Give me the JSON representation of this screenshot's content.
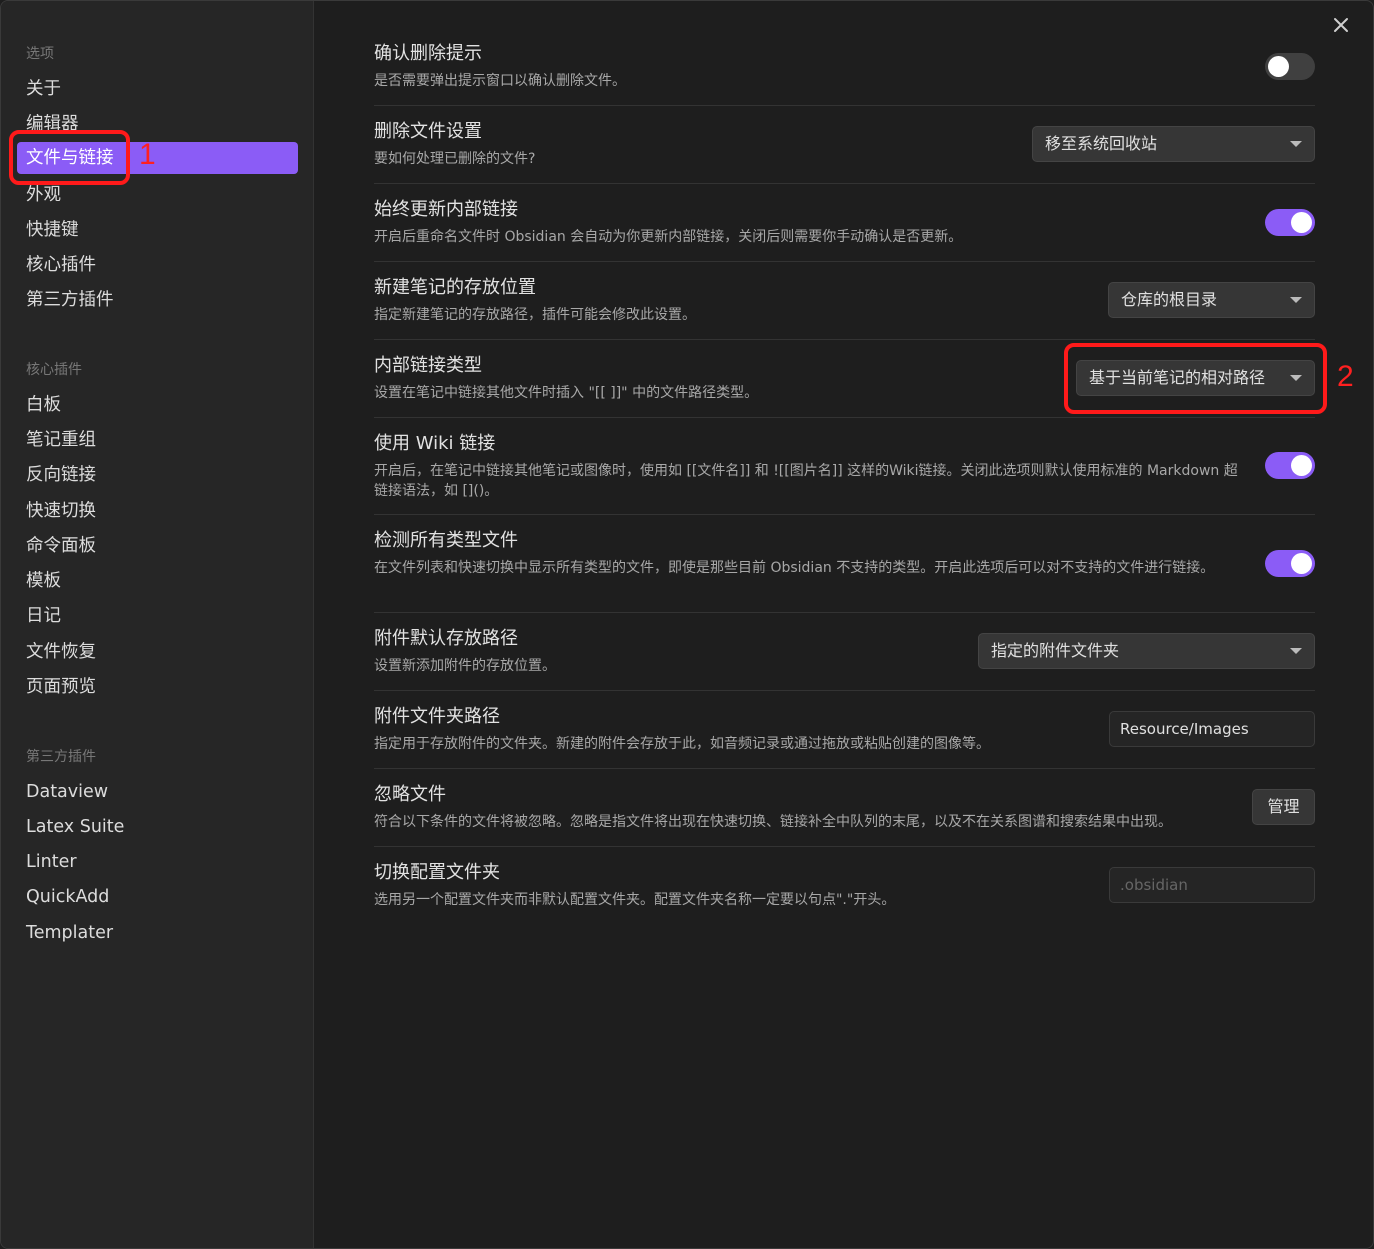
{
  "sidebar": {
    "heading_options": "选项",
    "options": [
      "关于",
      "编辑器",
      "文件与链接",
      "外观",
      "快捷键",
      "核心插件",
      "第三方插件"
    ],
    "heading_core": "核心插件",
    "core": [
      "白板",
      "笔记重组",
      "反向链接",
      "快速切换",
      "命令面板",
      "模板",
      "日记",
      "文件恢复",
      "页面预览"
    ],
    "heading_third": "第三方插件",
    "third": [
      "Dataview",
      "Latex Suite",
      "Linter",
      "QuickAdd",
      "Templater"
    ]
  },
  "annotations": {
    "one": "1",
    "two": "2",
    "color": "#ff1a1a"
  },
  "accent_color": "#8b5cf6",
  "settings": {
    "confirm_delete": {
      "title": "确认删除提示",
      "desc": "是否需要弹出提示窗口以确认删除文件。",
      "toggle": "off"
    },
    "delete_files": {
      "title": "删除文件设置",
      "desc": "要如何处理已删除的文件?",
      "value": "移至系统回收站"
    },
    "auto_update_links": {
      "title": "始终更新内部链接",
      "desc": "开启后重命名文件时 Obsidian 会自动为你更新内部链接，关闭后则需要你手动确认是否更新。",
      "toggle": "on"
    },
    "new_note_location": {
      "title": "新建笔记的存放位置",
      "desc": "指定新建笔记的存放路径，插件可能会修改此设置。",
      "value": "仓库的根目录"
    },
    "link_type": {
      "title": "内部链接类型",
      "desc": "设置在笔记中链接其他文件时插入 \"[[ ]]\" 中的文件路径类型。",
      "value": "基于当前笔记的相对路径"
    },
    "wiki_links": {
      "title": "使用 Wiki 链接",
      "desc": "开启后，在笔记中链接其他笔记或图像时，使用如 [[文件名]] 和 ![[图片名]] 这样的Wiki链接。关闭此选项则默认使用标准的 Markdown 超链接语法，如 []()。",
      "toggle": "on"
    },
    "detect_all": {
      "title": "检测所有类型文件",
      "desc": "在文件列表和快速切换中显示所有类型的文件，即使是那些目前 Obsidian 不支持的类型。开启此选项后可以对不支持的文件进行链接。",
      "toggle": "on"
    },
    "attach_location": {
      "title": "附件默认存放路径",
      "desc": "设置新添加附件的存放位置。",
      "value": "指定的附件文件夹"
    },
    "attach_folder": {
      "title": "附件文件夹路径",
      "desc": "指定用于存放附件的文件夹。新建的附件会存放于此，如音频记录或通过拖放或粘贴创建的图像等。",
      "value": "Resource/Images"
    },
    "ignore_files": {
      "title": "忽略文件",
      "desc": "符合以下条件的文件将被忽略。忽略是指文件将出现在快速切换、链接补全中队列的末尾，以及不在关系图谱和搜索结果中出现。",
      "button": "管理"
    },
    "config_folder": {
      "title": "切换配置文件夹",
      "desc": "选用另一个配置文件夹而非默认配置文件夹。配置文件夹名称一定要以句点\".\"开头。",
      "placeholder": ".obsidian"
    }
  }
}
